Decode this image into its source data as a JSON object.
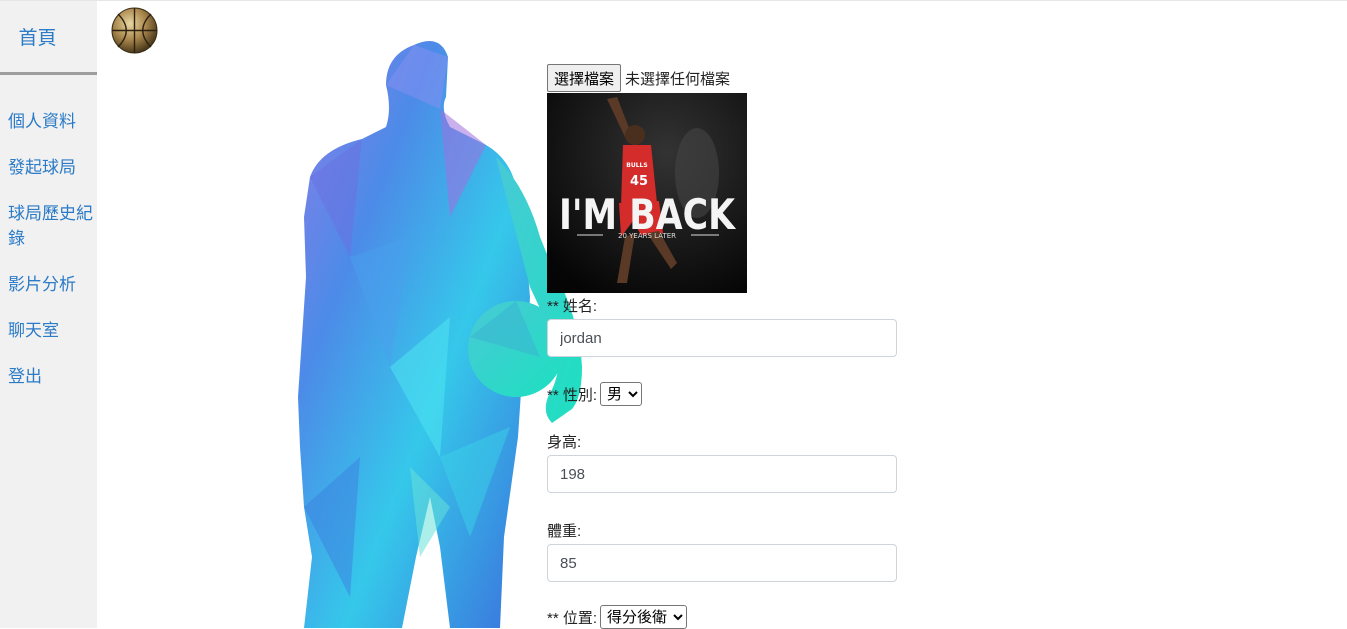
{
  "sidebar": {
    "home": "首頁",
    "items": [
      {
        "label": "個人資料"
      },
      {
        "label": "發起球局"
      },
      {
        "label": "球局歷史紀錄"
      },
      {
        "label": "影片分析"
      },
      {
        "label": "聊天室"
      },
      {
        "label": "登出"
      }
    ]
  },
  "form": {
    "file_button": "選擇檔案",
    "file_status": "未選擇任何檔案",
    "photo": {
      "headline": "I'M BACK",
      "subline": "20 YEARS LATER",
      "jersey": "45",
      "team": "BULLS"
    },
    "name_label": "** 姓名:",
    "name_value": "jordan",
    "gender_label": "** 性別:",
    "gender_value": "男",
    "height_label": "身高:",
    "height_value": "198",
    "weight_label": "體重:",
    "weight_value": "85",
    "position_label": "** 位置:",
    "position_value": "得分後衛"
  },
  "colors": {
    "link": "#2b7bc7",
    "sidebar_bg": "#f1f1f1"
  }
}
